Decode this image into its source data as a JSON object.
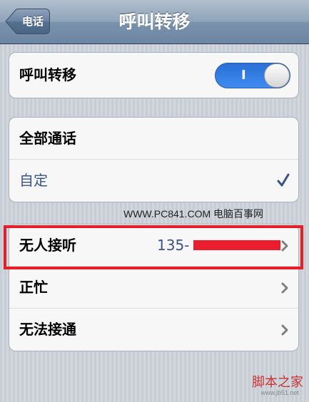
{
  "nav": {
    "title": "呼叫转移",
    "back_label": "电话"
  },
  "forwarding": {
    "label": "呼叫转移",
    "toggle_text": "I",
    "toggle_on": true
  },
  "mode_group": {
    "items": [
      {
        "label": "全部通话",
        "selected": false
      },
      {
        "label": "自定",
        "selected": true
      }
    ]
  },
  "conditions": {
    "items": [
      {
        "label": "无人接听",
        "value": "135-"
      },
      {
        "label": "正忙",
        "value": ""
      },
      {
        "label": "无法接通",
        "value": ""
      }
    ]
  },
  "watermarks": {
    "top": "WWW.PC841.COM 电脑百事网",
    "bottom": "脚本之家",
    "bottom_url": "www.jb51.net"
  },
  "colors": {
    "toggle_blue": "#3f8cf2",
    "selected_text": "#385487",
    "highlight_red": "#e51e2a"
  }
}
